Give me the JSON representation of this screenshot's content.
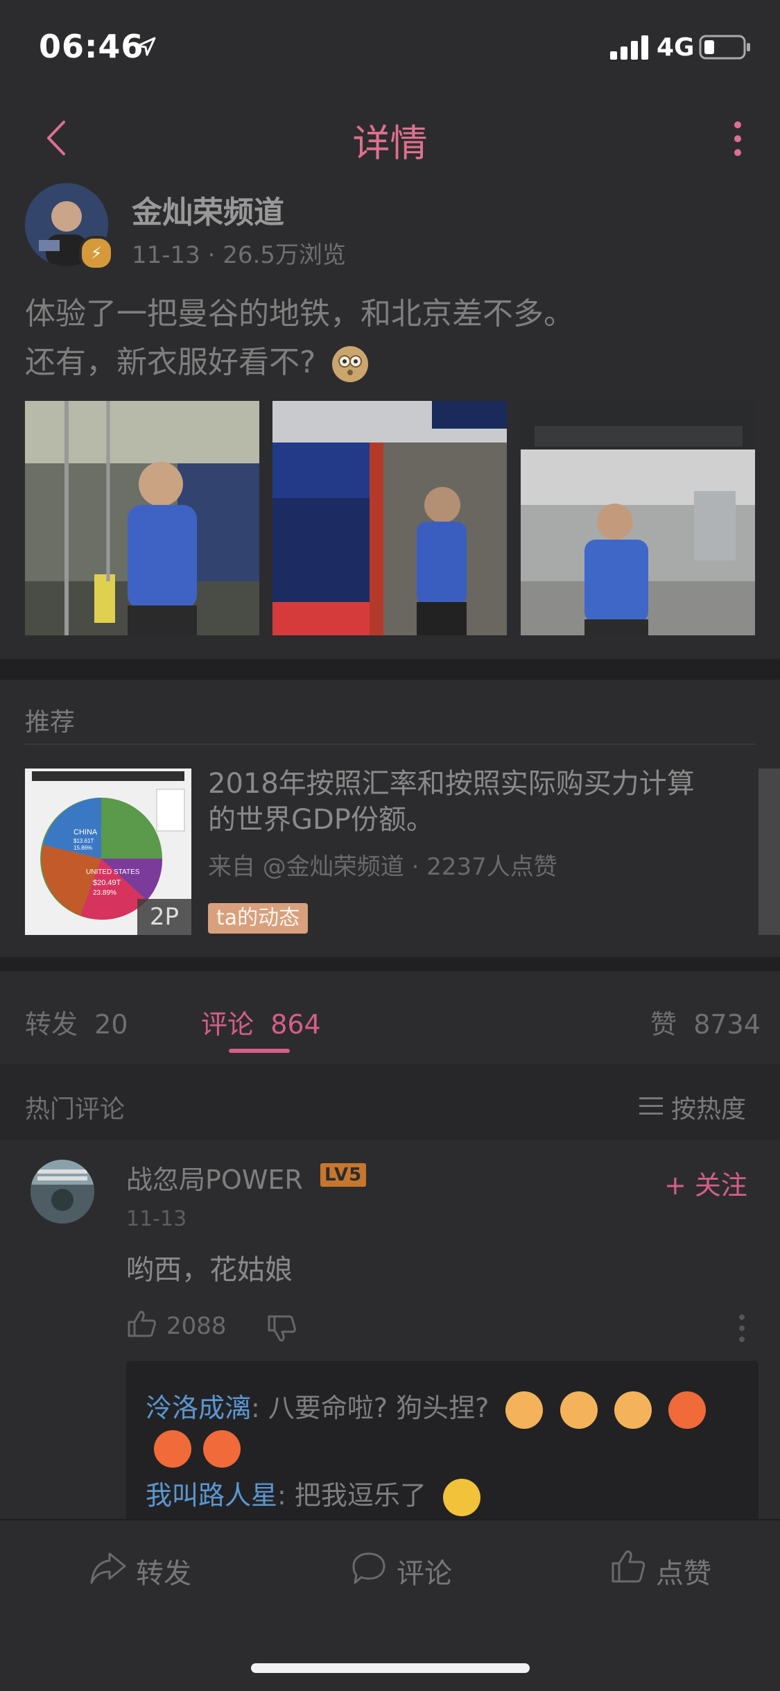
{
  "status": {
    "time": "06:46",
    "network": "4G"
  },
  "nav": {
    "title": "详情"
  },
  "post": {
    "author": "金灿荣频道",
    "date": "11-13",
    "views": "26.5万浏览",
    "text_line1": "体验了一把曼谷的地铁，和北京差不多。",
    "text_line2": "还有，新衣服好看不?",
    "images": [
      {
        "icon": "photo-subway-car"
      },
      {
        "icon": "photo-platform"
      },
      {
        "icon": "photo-station-hall"
      }
    ]
  },
  "recommend": {
    "section_title": "推荐",
    "headline": "2018年按照汇率和按照实际购买力计算的世界GDP份额。",
    "source": "来自 @金灿荣频道 · 2237人点赞",
    "badge": "2P",
    "tag": "ta的动态",
    "thumb_labels": {
      "china": "CHINA",
      "china_value": "$13.61T",
      "china_share": "15.86%",
      "us": "UNITED STATES",
      "us_value": "$20.49T",
      "us_share": "23.89%"
    }
  },
  "tabs": {
    "repost_label": "转发",
    "repost_count": "20",
    "comment_label": "评论",
    "comment_count": "864",
    "like_label": "赞",
    "like_count": "8734"
  },
  "comments_header": {
    "title": "热门评论",
    "sort": "按热度"
  },
  "comment": {
    "name": "战忽局POWER",
    "level": "LV5",
    "follow": "+ 关注",
    "date": "11-13",
    "text": "哟西，花姑娘",
    "likes": "2088",
    "replies": [
      {
        "user": "泠洛成漓",
        "text": ": 八要命啦? 狗头捏?"
      },
      {
        "user": "我叫路人星",
        "text": ": 把我逗乐了"
      }
    ]
  },
  "bottom_bar": {
    "repost": "转发",
    "comment": "评论",
    "like": "点赞"
  },
  "colors": {
    "accent": "#e0708f",
    "link": "#5b97d1",
    "background": "#2c2c2e"
  }
}
